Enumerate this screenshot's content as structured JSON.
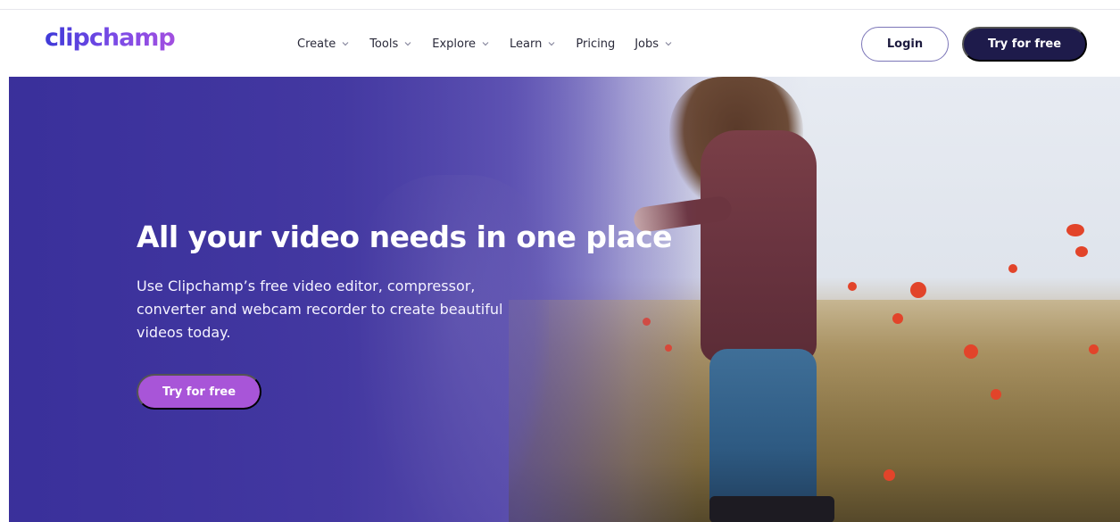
{
  "brand": {
    "logo_text": "clipchamp",
    "accent": "#6a4ee8",
    "dark": "#1e1b4b",
    "cta_purple": "#a855d8"
  },
  "header": {
    "nav": [
      {
        "label": "Create",
        "has_dropdown": true,
        "icon": "chevron-down-icon"
      },
      {
        "label": "Tools",
        "has_dropdown": true,
        "icon": "chevron-down-icon"
      },
      {
        "label": "Explore",
        "has_dropdown": true,
        "icon": "chevron-down-icon"
      },
      {
        "label": "Learn",
        "has_dropdown": true,
        "icon": "chevron-down-icon"
      },
      {
        "label": "Pricing",
        "has_dropdown": false
      },
      {
        "label": "Jobs",
        "has_dropdown": true,
        "icon": "chevron-down-icon"
      }
    ],
    "login_label": "Login",
    "try_label": "Try for free"
  },
  "hero": {
    "title": "All your video needs in one place",
    "subtitle": "Use Clipchamp’s free video editor, compressor, converter and webcam recorder to create beautiful videos today.",
    "cta_label": "Try for free"
  }
}
